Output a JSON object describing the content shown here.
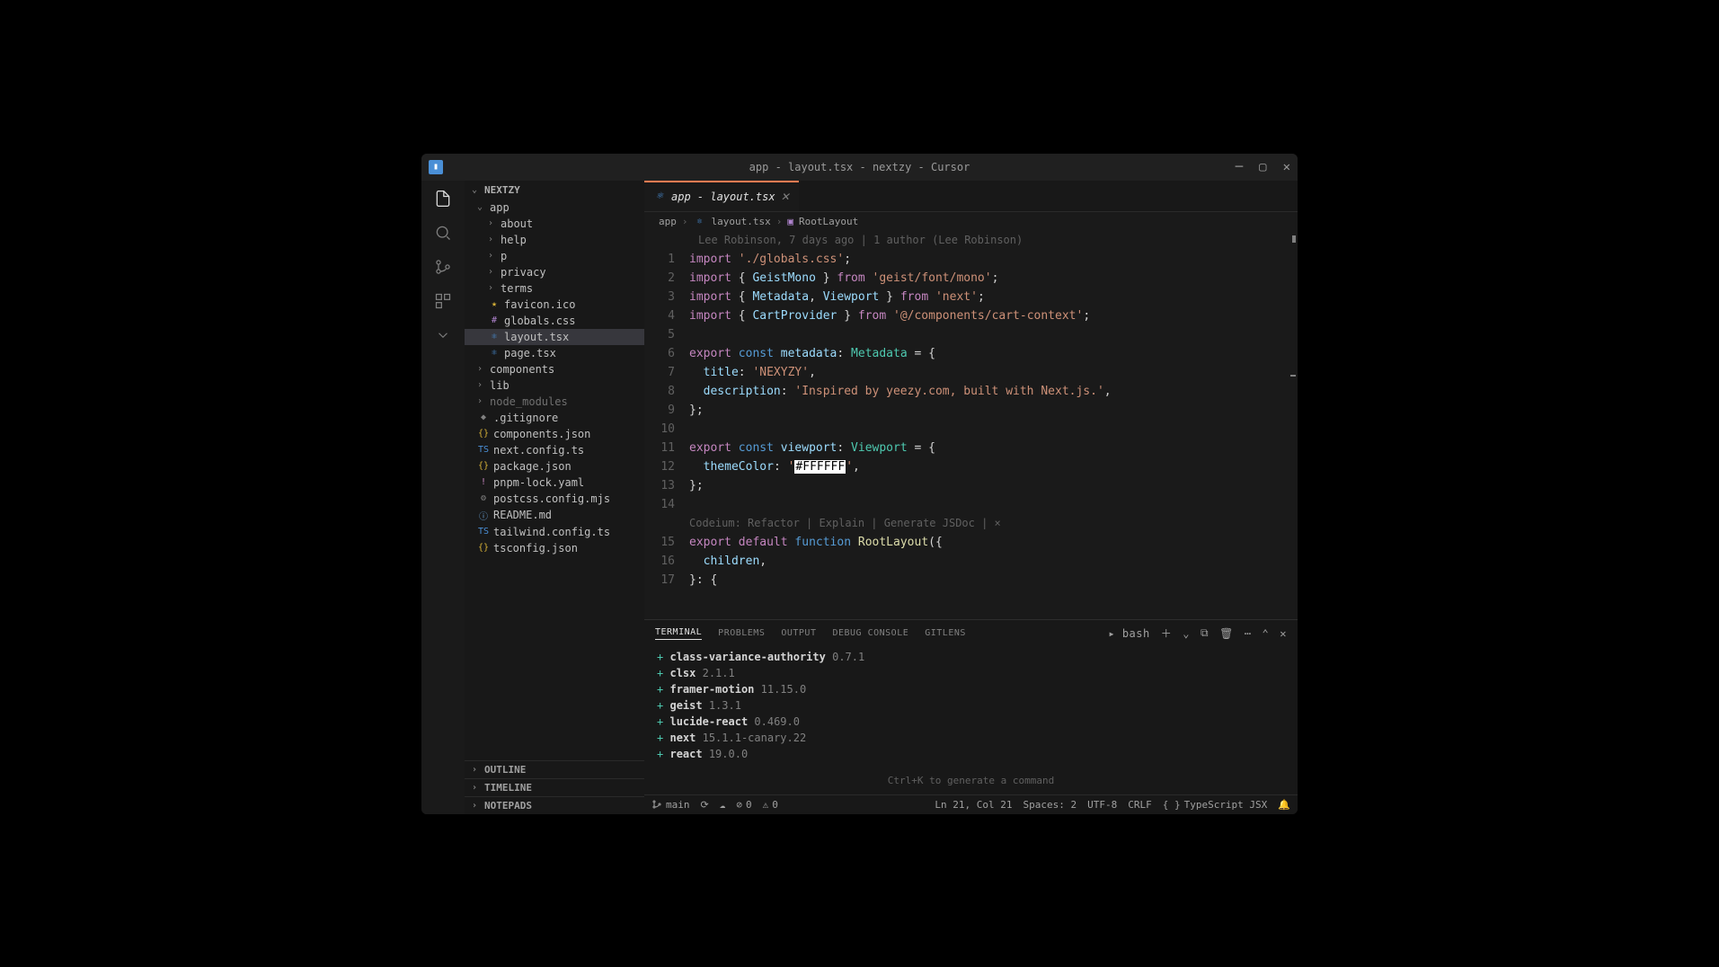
{
  "window": {
    "title": "app - layout.tsx - nextzy - Cursor"
  },
  "sidebar": {
    "project": "NEXTZY",
    "tree": {
      "app": "app",
      "about": "about",
      "help": "help",
      "p": "p",
      "privacy": "privacy",
      "terms": "terms",
      "favicon": "favicon.ico",
      "globals": "globals.css",
      "layout": "layout.tsx",
      "page": "page.tsx",
      "components": "components",
      "lib": "lib",
      "node_modules": "node_modules",
      "gitignore": ".gitignore",
      "componentsjson": "components.json",
      "nextconfig": "next.config.ts",
      "packagejson": "package.json",
      "pnpmlock": "pnpm-lock.yaml",
      "postcss": "postcss.config.mjs",
      "readme": "README.md",
      "tailwind": "tailwind.config.ts",
      "tsconfig": "tsconfig.json"
    },
    "footer": {
      "outline": "OUTLINE",
      "timeline": "TIMELINE",
      "notepads": "NOTEPADS"
    }
  },
  "tab": {
    "label": "app - layout.tsx"
  },
  "breadcrumb": {
    "app": "app",
    "file": "layout.tsx",
    "symbol": "RootLayout"
  },
  "codelens_top": "Lee Robinson, 7 days ago | 1 author (Lee Robinson)",
  "code": {
    "l1_import": "import",
    "l1_str": "'./globals.css'",
    "l2_import": "import",
    "l2_brace1": "{ ",
    "l2_ident": "GeistMono",
    "l2_brace2": " }",
    "l2_from": "from",
    "l2_str": "'geist/font/mono'",
    "l3_import": "import",
    "l3_brace1": "{ ",
    "l3_ident1": "Metadata",
    "l3_comma": ", ",
    "l3_ident2": "Viewport",
    "l3_brace2": " }",
    "l3_from": "from",
    "l3_str": "'next'",
    "l4_import": "import",
    "l4_brace1": "{ ",
    "l4_ident": "CartProvider",
    "l4_brace2": " }",
    "l4_from": "from",
    "l4_str": "'@/components/cart-context'",
    "l6_export": "export",
    "l6_const": "const",
    "l6_ident": "metadata",
    "l6_type": "Metadata",
    "l7_key": "title",
    "l7_str": "'NEXYZY'",
    "l8_key": "description",
    "l8_str": "'Inspired by yeezy.com, built with Next.js.'",
    "l11_export": "export",
    "l11_const": "const",
    "l11_ident": "viewport",
    "l11_type": "Viewport",
    "l12_key": "themeColor",
    "l12_q1": "'",
    "l12_hl": "#FFFFFF",
    "l12_q2": "'",
    "codeium": "Codeium: Refactor | Explain | Generate JSDoc | ×",
    "l15_export": "export",
    "l15_default": "default",
    "l15_function": "function",
    "l15_name": "RootLayout",
    "l16_children": "children"
  },
  "linenos": {
    "l1": "1",
    "l2": "2",
    "l3": "3",
    "l4": "4",
    "l5": "5",
    "l6": "6",
    "l7": "7",
    "l8": "8",
    "l9": "9",
    "l10": "10",
    "l11": "11",
    "l12": "12",
    "l13": "13",
    "l14": "14",
    "l15": "15",
    "l16": "16",
    "l17": "17"
  },
  "panel": {
    "tabs": {
      "terminal": "TERMINAL",
      "problems": "PROBLEMS",
      "output": "OUTPUT",
      "debug": "DEBUG CONSOLE",
      "gitlens": "GITLENS"
    },
    "shell": "bash",
    "lines": [
      {
        "pkg": "class-variance-authority",
        "ver": "0.7.1"
      },
      {
        "pkg": "clsx",
        "ver": "2.1.1"
      },
      {
        "pkg": "framer-motion",
        "ver": "11.15.0"
      },
      {
        "pkg": "geist",
        "ver": "1.3.1"
      },
      {
        "pkg": "lucide-react",
        "ver": "0.469.0"
      },
      {
        "pkg": "next",
        "ver": "15.1.1-canary.22"
      },
      {
        "pkg": "react",
        "ver": "19.0.0"
      }
    ],
    "hint": "Ctrl+K to generate a command"
  },
  "status": {
    "branch": "main",
    "errors": "0",
    "warnings": "0",
    "pos": "Ln 21, Col 21",
    "spaces": "Spaces: 2",
    "encoding": "UTF-8",
    "eol": "CRLF",
    "lang": "TypeScript JSX"
  }
}
